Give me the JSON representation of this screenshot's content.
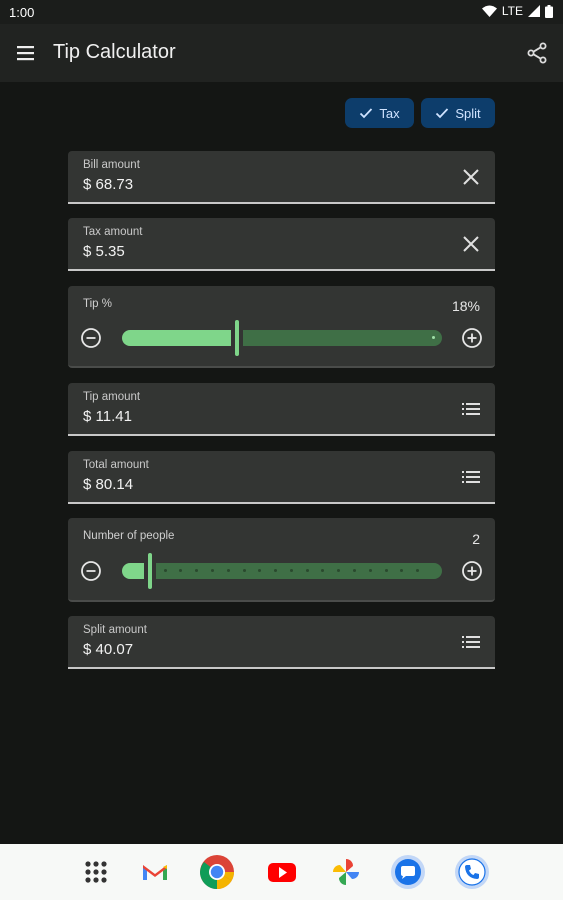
{
  "status_bar": {
    "time": "1:00",
    "network": "LTE"
  },
  "app_bar": {
    "title": "Tip Calculator",
    "menu_icon": "hamburger-menu-icon",
    "share_icon": "share-icon"
  },
  "chips": [
    {
      "label": "Tax",
      "selected": true
    },
    {
      "label": "Split",
      "selected": true
    }
  ],
  "fields": {
    "bill": {
      "label": "Bill amount",
      "value": "$ 68.73",
      "icon": "clear-icon"
    },
    "tax": {
      "label": "Tax amount",
      "value": "$ 5.35",
      "icon": "clear-icon"
    },
    "tip_amount": {
      "label": "Tip amount",
      "value": "$ 11.41",
      "icon": "list-icon"
    },
    "total": {
      "label": "Total amount",
      "value": "$ 80.14",
      "icon": "list-icon"
    },
    "split": {
      "label": "Split amount",
      "value": "$ 40.07",
      "icon": "list-icon"
    }
  },
  "tip_slider": {
    "label": "Tip %",
    "value_text": "18%",
    "fraction": 0.36
  },
  "people_slider": {
    "label": "Number of people",
    "value_text": "2",
    "value": 2,
    "min": 1,
    "max": 20
  },
  "colors": {
    "accent": "#7fd68a",
    "chip_bg": "#0d3d6b",
    "surface": "#333533",
    "background": "#141614"
  },
  "nav_bar": {
    "apps": [
      "app-drawer-icon",
      "gmail-icon",
      "chrome-icon",
      "youtube-icon",
      "photos-icon",
      "messages-icon",
      "phone-icon"
    ]
  }
}
